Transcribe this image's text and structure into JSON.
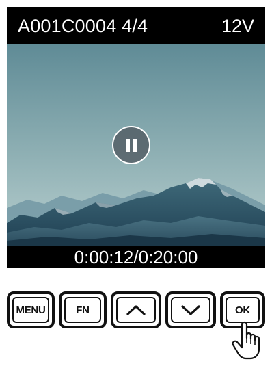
{
  "screen": {
    "clip_label": "A001C0004 4/4",
    "voltage": "12V",
    "timecode": "0:00:12/0:20:00",
    "playback_icon": "pause-icon"
  },
  "buttons": [
    {
      "id": "menu",
      "label": "MENU",
      "icon": ""
    },
    {
      "id": "fn",
      "label": "FN",
      "icon": ""
    },
    {
      "id": "up",
      "label": "",
      "icon": "chevron-up-icon"
    },
    {
      "id": "down",
      "label": "",
      "icon": "chevron-down-icon"
    },
    {
      "id": "ok",
      "label": "OK",
      "icon": ""
    }
  ],
  "pointer_icon": "hand-pointer-icon",
  "colors": {
    "screen_bg": "#000000",
    "text": "#ffffff",
    "sky_top": "#5f8b96",
    "sky_bottom": "#a9c6c8"
  }
}
